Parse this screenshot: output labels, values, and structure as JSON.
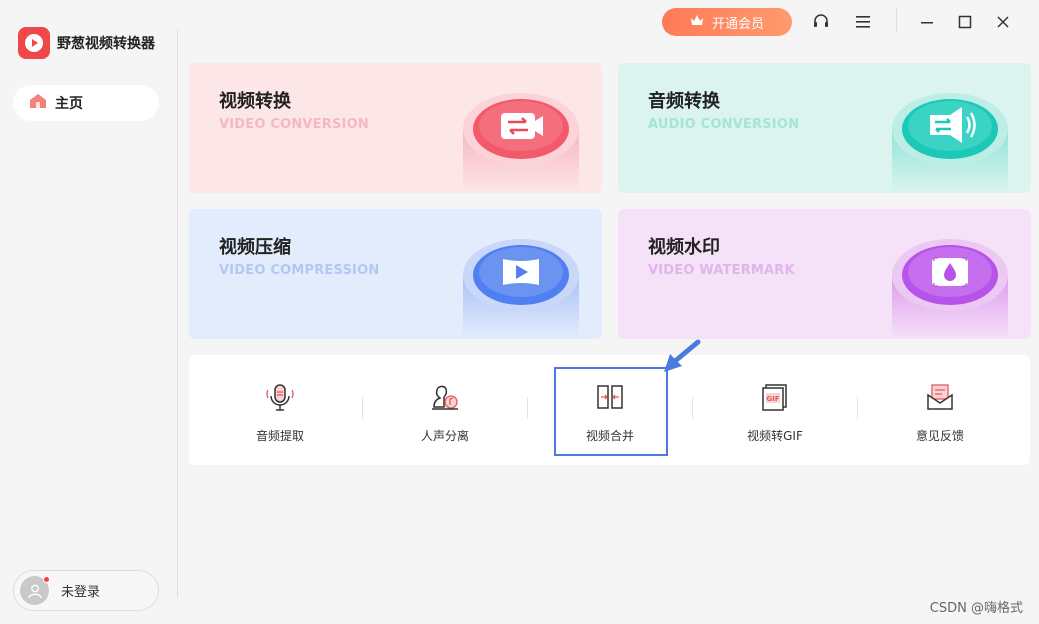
{
  "app": {
    "name": "野葱视频转换器"
  },
  "sidebar": {
    "home_label": "主页",
    "login_label": "未登录"
  },
  "topbar": {
    "vip_label": "开通会员"
  },
  "cards": [
    {
      "title": "视频转换",
      "subtitle": "VIDEO CONVERSION",
      "accent": "#f0475e",
      "bg": "#fde6e8",
      "subcolor": "#f4b9bf"
    },
    {
      "title": "音频转换",
      "subtitle": "AUDIO CONVERSION",
      "accent": "#1cc8b8",
      "bg": "#dbf4ef",
      "subcolor": "#a6e3d8"
    },
    {
      "title": "视频压缩",
      "subtitle": "VIDEO COMPRESSION",
      "accent": "#4f7ff0",
      "bg": "#e3ecfc",
      "subcolor": "#b3c7f1"
    },
    {
      "title": "视频水印",
      "subtitle": "VIDEO WATERMARK",
      "accent": "#b653e8",
      "bg": "#f5e1f8",
      "subcolor": "#e0b6ea"
    }
  ],
  "tools": [
    {
      "label": "音频提取",
      "icon": "microphone-icon"
    },
    {
      "label": "人声分离",
      "icon": "voice-separation-icon"
    },
    {
      "label": "视频合并",
      "icon": "video-merge-icon"
    },
    {
      "label": "视频转GIF",
      "icon": "gif-icon"
    },
    {
      "label": "意见反馈",
      "icon": "feedback-icon"
    }
  ],
  "watermark": "CSDN @嗨格式"
}
